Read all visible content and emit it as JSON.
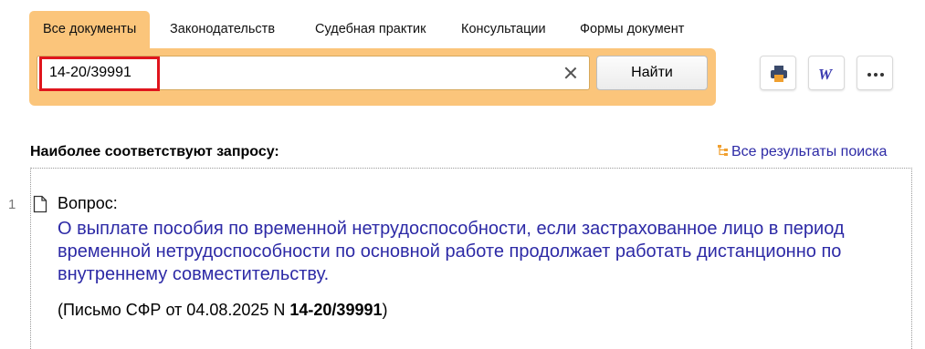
{
  "tabs": [
    {
      "label": "Все документы",
      "active": true
    },
    {
      "label": "Законодательств",
      "active": false
    },
    {
      "label": "Судебная практик",
      "active": false
    },
    {
      "label": "Консультации",
      "active": false
    },
    {
      "label": "Формы документ",
      "active": false
    }
  ],
  "search": {
    "query": "14-20/39991",
    "find_label": "Найти"
  },
  "toolbar": {
    "icons": [
      "print-icon",
      "word-icon",
      "more-icon"
    ]
  },
  "results": {
    "heading": "Наиболее соответствуют запросу:",
    "all_results_label": "Все результаты поиска",
    "items": [
      {
        "index": "1",
        "label": "Вопрос:",
        "title": "О выплате пособия по временной нетрудоспособности, если застрахованное лицо в период временной нетрудоспособности по основной работе продолжает работать дистанционно по внутреннему совместительству.",
        "source_prefix": "(Письмо СФР от 04.08.2025 N ",
        "source_number": "14-20/39991",
        "source_suffix": ")"
      }
    ]
  },
  "colors": {
    "accent": "#fbc57b",
    "link": "#2d2aa6",
    "highlight": "#e0151d"
  }
}
